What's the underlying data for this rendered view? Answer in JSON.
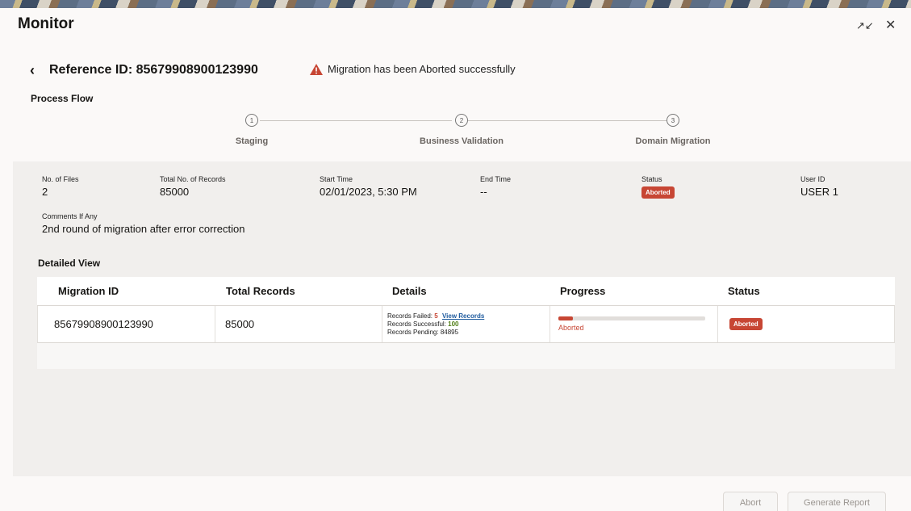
{
  "window": {
    "title": "Monitor"
  },
  "header": {
    "reference_label": "Reference ID: 85679908900123990",
    "alert_text": "Migration has been Aborted successfully"
  },
  "process_flow": {
    "title": "Process Flow",
    "steps": [
      {
        "number": "1",
        "label": "Staging"
      },
      {
        "number": "2",
        "label": "Business Validation"
      },
      {
        "number": "3",
        "label": "Domain Migration"
      }
    ]
  },
  "summary": {
    "files_label": "No. of Files",
    "files_value": "2",
    "records_label": "Total No. of Records",
    "records_value": "85000",
    "start_label": "Start Time",
    "start_value": "02/01/2023, 5:30 PM",
    "end_label": "End Time",
    "end_value": "--",
    "status_label": "Status",
    "status_value": "Aborted",
    "user_label": "User ID",
    "user_value": "USER 1",
    "comments_label": "Comments If Any",
    "comments_value": "2nd round of migration after error correction"
  },
  "detailed_view": {
    "title": "Detailed View",
    "columns": [
      "Migration ID",
      "Total Records",
      "Details",
      "Progress",
      "Status"
    ],
    "rows": [
      {
        "migration_id": "85679908900123990",
        "total_records": "85000",
        "failed_label": "Records Failed:",
        "failed_value": "5",
        "view_link": "View Records",
        "successful_label": "Records Successful:",
        "successful_value": "100",
        "pending_label": "Records Pending:",
        "pending_value": "84895",
        "progress_percent": 10,
        "progress_text": "Aborted",
        "status": "Aborted"
      }
    ]
  },
  "footer": {
    "abort_label": "Abort",
    "report_label": "Generate Report"
  },
  "colors": {
    "accent_red": "#c74634",
    "link_blue": "#1f5b9e",
    "success_green": "#4f7d14"
  }
}
